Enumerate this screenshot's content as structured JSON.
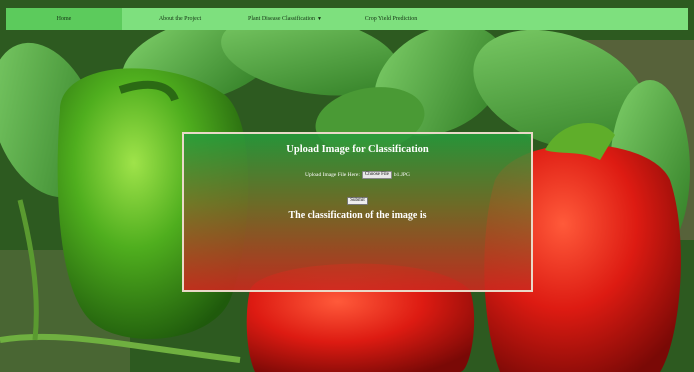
{
  "nav": {
    "items": [
      {
        "label": "Home"
      },
      {
        "label": "About the Project"
      },
      {
        "label": "Plant Disease Classification"
      },
      {
        "label": "Crop Yield Prediction"
      }
    ]
  },
  "upload": {
    "title": "Upload Image for Classification",
    "file_label": "Upload Image File Here:",
    "choose_button": "Choose File",
    "file_name": "b1.JPG",
    "submit_button": "Submit",
    "result_text": "The classification of the image is"
  },
  "colors": {
    "navbar": "#7ee07e",
    "nav_active": "#5ccb5c",
    "panel_top": "#269c3c",
    "panel_bottom": "#cd281e"
  }
}
